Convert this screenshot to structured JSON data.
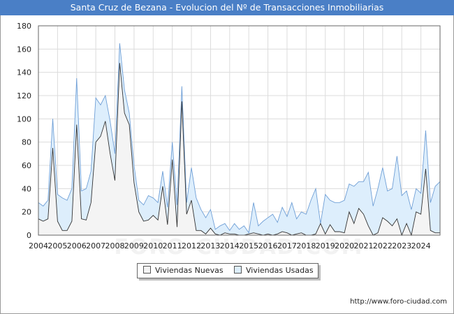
{
  "title": "Santa Cruz de Bezana - Evolucion del Nº de Transacciones Inmobiliarias",
  "source": "http://www.foro-ciudad.com",
  "watermark": "FORO-CIUDAD.COM",
  "colors": {
    "titlebar": "#4a7fc6",
    "nuevas_fill": "#f4f4f4",
    "nuevas_line": "#333333",
    "usadas_fill": "#ddeefc",
    "usadas_line": "#6f9fd6"
  },
  "legend": {
    "items": [
      {
        "label": "Viviendas Nuevas"
      },
      {
        "label": "Viviendas Usadas"
      }
    ]
  },
  "chart_data": {
    "type": "area",
    "title": "Santa Cruz de Bezana - Evolucion del Nº de Transacciones Inmobiliarias",
    "xlabel": "",
    "ylabel": "",
    "ylim": [
      0,
      180
    ],
    "yticks": [
      0,
      20,
      40,
      60,
      80,
      100,
      120,
      140,
      160,
      180
    ],
    "xticks": [
      "2004",
      "2005",
      "2006",
      "2007",
      "2008",
      "2009",
      "2010",
      "2011",
      "2012",
      "2013",
      "2014",
      "2015",
      "2016",
      "2017",
      "2018",
      "2019",
      "2020",
      "2021",
      "2022",
      "2023",
      "2024"
    ],
    "x_start": "2004 T1",
    "grid": true,
    "legend_position": "bottom",
    "series": [
      {
        "name": "Viviendas Nuevas",
        "values": [
          14,
          12,
          14,
          75,
          12,
          4,
          4,
          12,
          95,
          14,
          13,
          28,
          80,
          85,
          98,
          70,
          47,
          148,
          105,
          95,
          45,
          20,
          12,
          13,
          17,
          13,
          42,
          9,
          65,
          7,
          115,
          18,
          30,
          4,
          4,
          1,
          6,
          1,
          0,
          2,
          1,
          1,
          0,
          0,
          1,
          2,
          1,
          0,
          1,
          0,
          1,
          3,
          2,
          0,
          1,
          2,
          0,
          0,
          1,
          10,
          1,
          9,
          3,
          3,
          2,
          20,
          10,
          23,
          18,
          8,
          0,
          2,
          15,
          12,
          8,
          14,
          0,
          10,
          0,
          20,
          18,
          57,
          4,
          2,
          2
        ]
      },
      {
        "name": "Viviendas Usadas",
        "values": [
          28,
          25,
          30,
          100,
          35,
          32,
          30,
          40,
          135,
          38,
          40,
          55,
          118,
          112,
          120,
          98,
          70,
          165,
          125,
          105,
          60,
          30,
          26,
          34,
          32,
          28,
          55,
          24,
          80,
          26,
          128,
          28,
          58,
          32,
          22,
          15,
          22,
          5,
          8,
          10,
          4,
          10,
          5,
          8,
          2,
          28,
          8,
          12,
          15,
          18,
          11,
          24,
          16,
          28,
          14,
          20,
          18,
          30,
          40,
          10,
          35,
          30,
          28,
          28,
          30,
          44,
          42,
          46,
          46,
          54,
          25,
          40,
          58,
          38,
          40,
          68,
          34,
          38,
          22,
          40,
          36,
          90,
          28,
          42,
          46
        ]
      }
    ]
  }
}
